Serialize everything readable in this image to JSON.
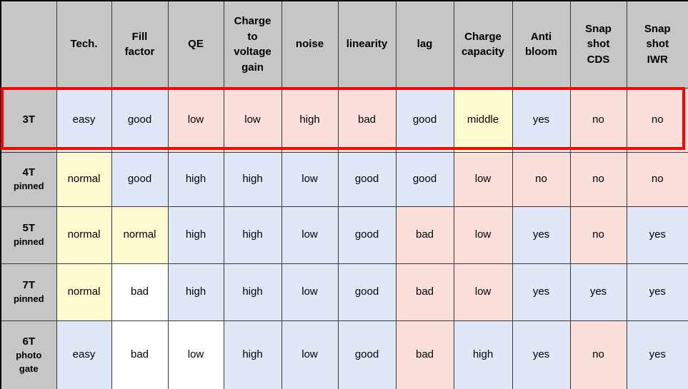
{
  "table": {
    "corner_label": "",
    "columns": [
      "Tech.",
      "Fill factor",
      "QE",
      "Charge to voltage gain",
      "noise",
      "linearity",
      "lag",
      "Charge capacity",
      "Anti bloom",
      "Snap shot CDS",
      "Snap shot IWR"
    ],
    "columns_lines": [
      [
        "Tech."
      ],
      [
        "Fill",
        "factor"
      ],
      [
        "QE"
      ],
      [
        "Charge",
        "to",
        "voltage",
        "gain"
      ],
      [
        "noise"
      ],
      [
        "linearity"
      ],
      [
        "lag"
      ],
      [
        "Charge",
        "capacity"
      ],
      [
        "Anti",
        "bloom"
      ],
      [
        "Snap",
        "shot",
        "CDS"
      ],
      [
        "Snap",
        "shot",
        "IWR"
      ]
    ],
    "rows": [
      {
        "id": "3T",
        "header_main": "3T",
        "header_sub": "",
        "highlighted": true,
        "cells": [
          {
            "value": "easy",
            "color": "blue"
          },
          {
            "value": "good",
            "color": "blue"
          },
          {
            "value": "low",
            "color": "pink"
          },
          {
            "value": "low",
            "color": "pink"
          },
          {
            "value": "high",
            "color": "pink"
          },
          {
            "value": "bad",
            "color": "pink"
          },
          {
            "value": "good",
            "color": "blue"
          },
          {
            "value": "middle",
            "color": "yellow"
          },
          {
            "value": "yes",
            "color": "blue"
          },
          {
            "value": "no",
            "color": "pink"
          },
          {
            "value": "no",
            "color": "pink"
          }
        ]
      },
      {
        "id": "4T",
        "header_main": "4T",
        "header_sub": "pinned",
        "highlighted": false,
        "cells": [
          {
            "value": "normal",
            "color": "yellow"
          },
          {
            "value": "good",
            "color": "blue"
          },
          {
            "value": "high",
            "color": "blue"
          },
          {
            "value": "high",
            "color": "blue"
          },
          {
            "value": "low",
            "color": "blue"
          },
          {
            "value": "good",
            "color": "blue"
          },
          {
            "value": "good",
            "color": "blue"
          },
          {
            "value": "low",
            "color": "pink"
          },
          {
            "value": "no",
            "color": "pink"
          },
          {
            "value": "no",
            "color": "pink"
          },
          {
            "value": "no",
            "color": "pink"
          }
        ]
      },
      {
        "id": "5T",
        "header_main": "5T",
        "header_sub": "pinned",
        "highlighted": false,
        "cells": [
          {
            "value": "normal",
            "color": "yellow"
          },
          {
            "value": "normal",
            "color": "yellow"
          },
          {
            "value": "high",
            "color": "blue"
          },
          {
            "value": "high",
            "color": "blue"
          },
          {
            "value": "low",
            "color": "blue"
          },
          {
            "value": "good",
            "color": "blue"
          },
          {
            "value": "bad",
            "color": "pink"
          },
          {
            "value": "low",
            "color": "pink"
          },
          {
            "value": "yes",
            "color": "blue"
          },
          {
            "value": "no",
            "color": "pink"
          },
          {
            "value": "yes",
            "color": "blue"
          }
        ]
      },
      {
        "id": "7T",
        "header_main": "7T",
        "header_sub": "pinned",
        "highlighted": false,
        "cells": [
          {
            "value": "normal",
            "color": "yellow"
          },
          {
            "value": "bad",
            "color": "white"
          },
          {
            "value": "high",
            "color": "blue"
          },
          {
            "value": "high",
            "color": "blue"
          },
          {
            "value": "low",
            "color": "blue"
          },
          {
            "value": "good",
            "color": "blue"
          },
          {
            "value": "bad",
            "color": "pink"
          },
          {
            "value": "low",
            "color": "pink"
          },
          {
            "value": "yes",
            "color": "blue"
          },
          {
            "value": "yes",
            "color": "blue"
          },
          {
            "value": "yes",
            "color": "blue"
          }
        ]
      },
      {
        "id": "6T",
        "header_main": "6T",
        "header_sub": "photo gate",
        "header_sub_lines": [
          "photo",
          "gate"
        ],
        "highlighted": false,
        "cells": [
          {
            "value": "easy",
            "color": "blue"
          },
          {
            "value": "bad",
            "color": "white"
          },
          {
            "value": "low",
            "color": "white"
          },
          {
            "value": "high",
            "color": "blue"
          },
          {
            "value": "low",
            "color": "blue"
          },
          {
            "value": "good",
            "color": "blue"
          },
          {
            "value": "bad",
            "color": "pink"
          },
          {
            "value": "high",
            "color": "blue"
          },
          {
            "value": "yes",
            "color": "blue"
          },
          {
            "value": "no",
            "color": "pink"
          },
          {
            "value": "yes",
            "color": "blue"
          }
        ]
      }
    ]
  },
  "colors": {
    "blue": "#e0e7f7",
    "pink": "#fadfda",
    "yellow": "#fdfbcf",
    "white": "#ffffff",
    "header_gray": "#c6c6c6",
    "highlight_red": "#ff0000",
    "grid_line": "#3a3a3a"
  },
  "annotation": {
    "highlight_row": "3T",
    "highlight_shape": "rectangle"
  }
}
